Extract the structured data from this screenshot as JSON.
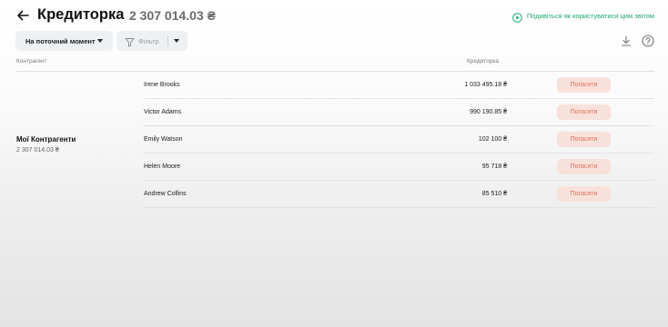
{
  "header": {
    "title": "Кредиторка",
    "total": "2 307 014.03 ₴",
    "help_link": "Подивіться як користуватися цим звітом"
  },
  "toolbar": {
    "period_label": "На поточний момент",
    "filter_label": "Фільтр"
  },
  "table": {
    "col_counterparty": "Контрагент",
    "col_payable": "Кредиторка",
    "group": {
      "name": "Мої Контрагенти",
      "total": "2 307 014.03 ₴"
    },
    "rows": [
      {
        "name": "Irene Brooks",
        "amount": "1 033 495.18 ₴",
        "action": "Погасити"
      },
      {
        "name": "Victor Adams",
        "amount": "990 190.85 ₴",
        "action": "Погасити"
      },
      {
        "name": "Emily Watson",
        "amount": "102 100 ₴",
        "action": "Погасити"
      },
      {
        "name": "Helen Moore",
        "amount": "95 718 ₴",
        "action": "Погасити"
      },
      {
        "name": "Andrew Collins",
        "amount": "85 510 ₴",
        "action": "Погасити"
      }
    ]
  },
  "colors": {
    "accent_green": "#1fa86b",
    "pay_button_bg": "#f8e1db",
    "pay_button_text": "#e0705a"
  },
  "icons": {
    "back": "arrow-left-icon",
    "help_link": "play-circle-icon",
    "filter": "funnel-icon",
    "download": "download-icon",
    "help": "question-circle-icon"
  }
}
